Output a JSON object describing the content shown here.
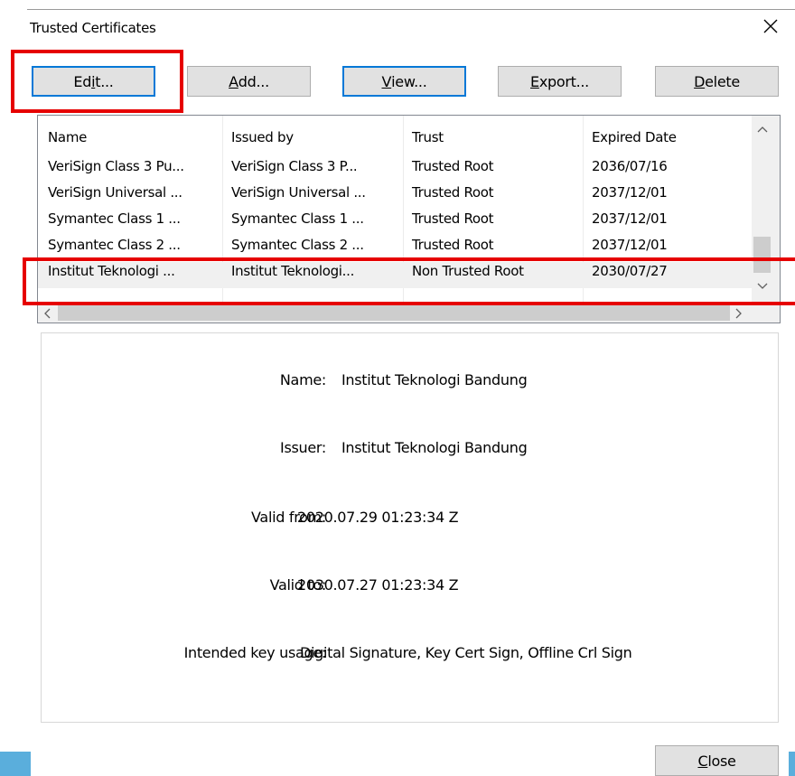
{
  "window": {
    "title": "Trusted Certificates",
    "close_icon": "close-icon"
  },
  "toolbar": {
    "edit": {
      "pre": "Ed",
      "mn": "i",
      "post": "t..."
    },
    "add": {
      "pre": "",
      "mn": "A",
      "post": "dd..."
    },
    "view": {
      "pre": "",
      "mn": "V",
      "post": "iew..."
    },
    "export": {
      "pre": "",
      "mn": "E",
      "post": "xport..."
    },
    "delete": {
      "pre": "",
      "mn": "D",
      "post": "elete"
    }
  },
  "table": {
    "columns": [
      "Name",
      "Issued by",
      "Trust",
      "Expired Date"
    ],
    "rows": [
      [
        "VeriSign Class 3 Pu...",
        "VeriSign Class 3 P...",
        "Trusted Root",
        "2036/07/16"
      ],
      [
        "VeriSign Universal ...",
        "VeriSign Universal ...",
        "Trusted Root",
        "2037/12/01"
      ],
      [
        "Symantec Class 1 ...",
        "Symantec Class 1 ...",
        "Trusted Root",
        "2037/12/01"
      ],
      [
        "Symantec Class 2 ...",
        "Symantec Class 2 ...",
        "Trusted Root",
        "2037/12/01"
      ],
      [
        "Institut Teknologi ...",
        "Institut Teknologi...",
        "Non Trusted Root",
        "2030/07/27"
      ]
    ],
    "selected_row": 4
  },
  "details": {
    "name_label": "Name:",
    "name_value": "Institut Teknologi Bandung",
    "issuer_label": "Issuer:",
    "issuer_value": "Institut Teknologi Bandung",
    "valid_from_label": "Valid from:",
    "valid_from_value": "2020.07.29 01:23:34 Z",
    "valid_to_label": "Valid to:",
    "valid_to_value": "2030.07.27 01:23:34 Z",
    "key_usage_label": "Intended key usage:",
    "key_usage_value": "Digital Signature, Key Cert Sign, Offline Crl Sign"
  },
  "footer": {
    "close": {
      "pre": "",
      "mn": "C",
      "post": "lose"
    }
  },
  "colors": {
    "highlight": "#e60000",
    "focus": "#0078d7",
    "button": "#e1e1e1"
  }
}
